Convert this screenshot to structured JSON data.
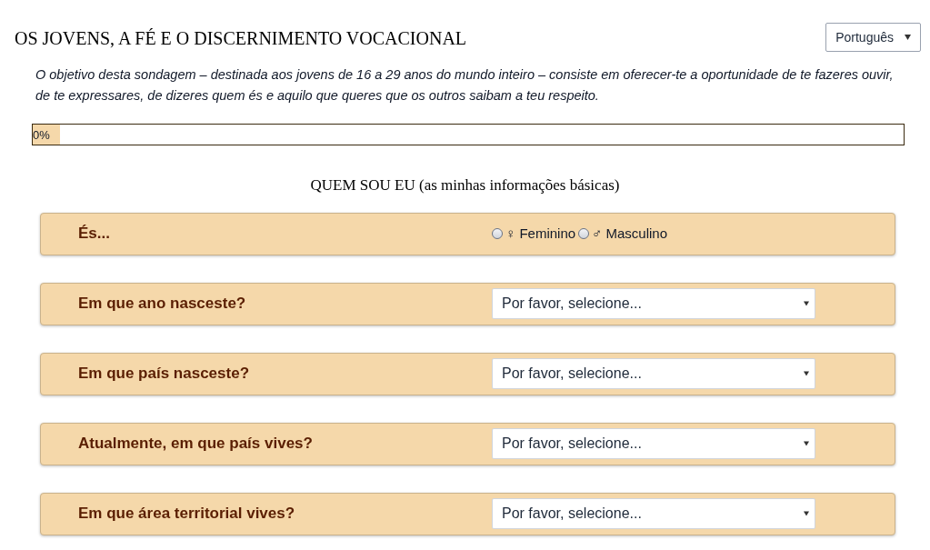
{
  "title": "OS JOVENS, A FÉ E O DISCERNIMENTO VOCACIONAL",
  "language_select": {
    "value": "Português"
  },
  "intro": "O objetivo desta sondagem – destinada aos jovens de 16 a 29 anos do mundo inteiro – consiste em oferecer-te a oportunidade de te fazeres ouvir, de te expressares, de dizeres quem és e aquilo que queres que os outros saibam a teu respeito.",
  "progress": {
    "level": 0,
    "reading": "0%"
  },
  "section_title": "QUEM SOU EU (as minhas informações básicas)",
  "questions": [
    {
      "kind": "radio",
      "label": "És...",
      "options": [
        {
          "label": "♀ Feminino",
          "selected": false
        },
        {
          "label": "♂ Masculino",
          "selected": false
        }
      ]
    },
    {
      "kind": "select",
      "label": "Em que ano nasceste?",
      "placeholder": "Por favor, selecione..."
    },
    {
      "kind": "select",
      "label": "Em que país nasceste?",
      "placeholder": "Por favor, selecione..."
    },
    {
      "kind": "select",
      "label": "Atualmente, em que país vives?",
      "placeholder": "Por favor, selecione..."
    },
    {
      "kind": "select",
      "label": "Em que área territorial vives?",
      "placeholder": "Por favor, selecione..."
    }
  ]
}
